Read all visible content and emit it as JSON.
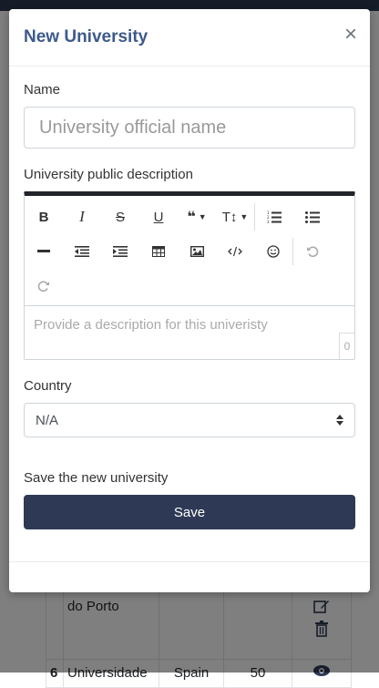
{
  "modal": {
    "title": "New University",
    "close_label": "×",
    "name_label": "Name",
    "name_placeholder": "University official name",
    "description_label": "University public description",
    "description_placeholder": "Provide a description for this univeristy",
    "char_count": "0",
    "country_label": "Country",
    "country_selected": "N/A",
    "save_hint": "Save the new university",
    "save_button": "Save"
  },
  "toolbar": {
    "bold": "B",
    "italic": "I",
    "strike": "S",
    "underline": "U",
    "quote": "❝",
    "text_size": "T↕"
  },
  "background_table": {
    "rows": [
      {
        "index": "",
        "name": "do Porto",
        "country": "",
        "score": ""
      },
      {
        "index": "6",
        "name": "Universidade",
        "country": "Spain",
        "score": "50"
      }
    ]
  },
  "colors": {
    "title": "#3d5a8a",
    "save_button_bg": "#2e3a55",
    "navbar": "#2d3a50"
  }
}
